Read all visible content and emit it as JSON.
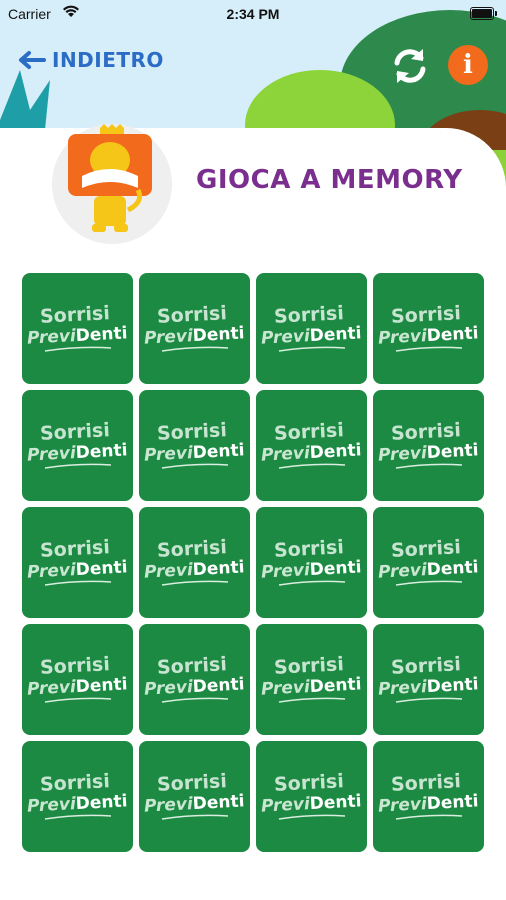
{
  "status_bar": {
    "carrier": "Carrier",
    "time": "2:34 PM"
  },
  "nav": {
    "back_label": "INDIETRO"
  },
  "header": {
    "title": "GIOCA A MEMORY"
  },
  "logo": {
    "line1": "Sorrisi",
    "prev": "Previ",
    "denti": "Denti"
  },
  "cards_count": 20,
  "colors": {
    "card": "#1c8a43",
    "title": "#7a2f8e",
    "back": "#2b6cc4",
    "info": "#f26a1b"
  }
}
